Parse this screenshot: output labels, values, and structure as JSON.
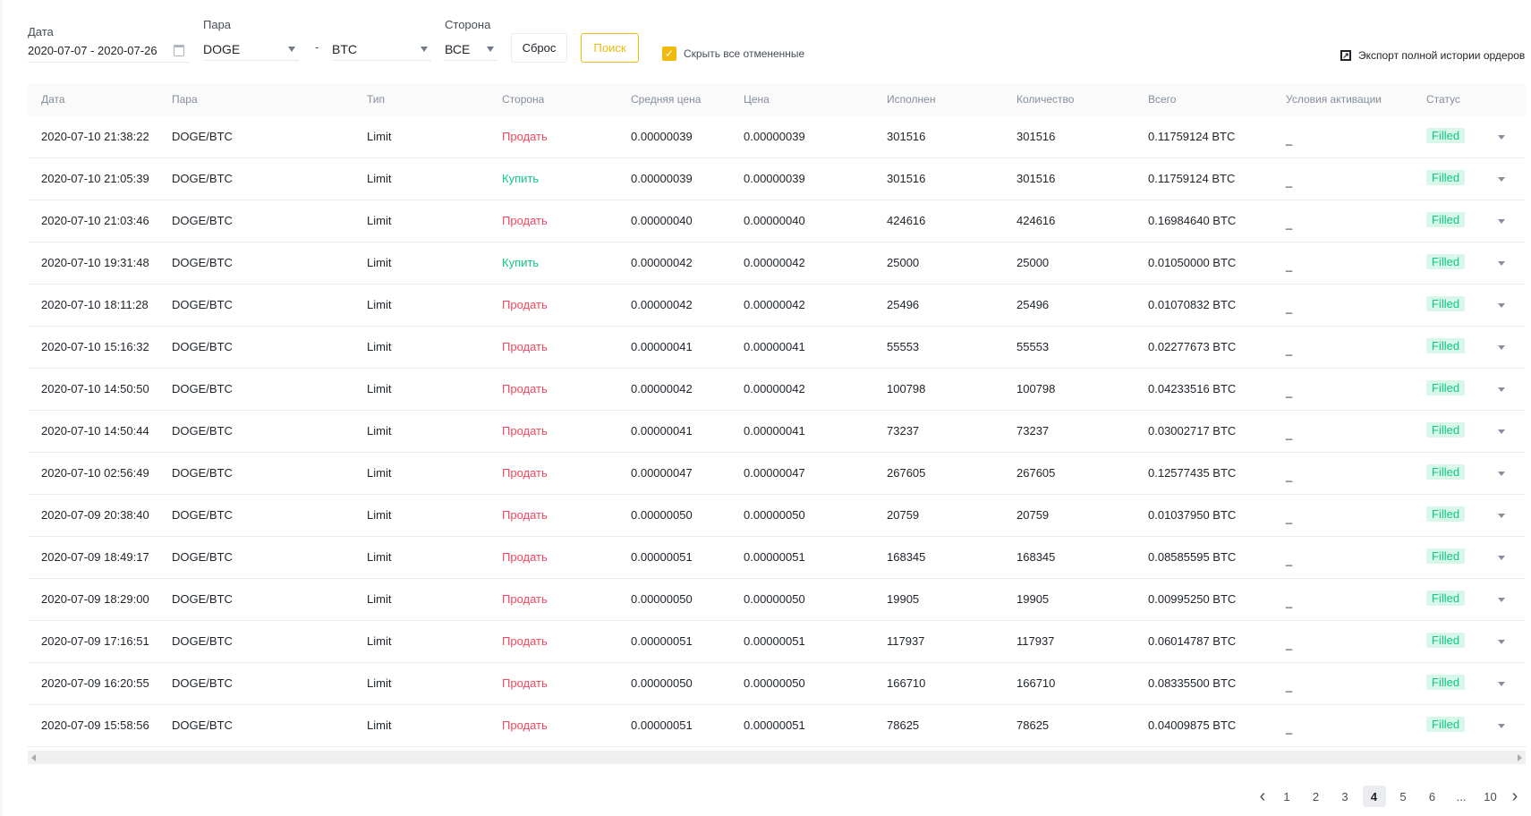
{
  "filters": {
    "date_label": "Дата",
    "date_value": "2020-07-07 - 2020-07-26",
    "pair_label": "Пара",
    "base": "DOGE",
    "dash": "-",
    "quote": "BTC",
    "side_label": "Сторона",
    "side_value": "ВСЕ",
    "reset": "Сброс",
    "search": "Поиск",
    "hide_cancelled": "Скрыть все отмененные",
    "export": "Экспорт полной истории ордеров"
  },
  "columns": [
    "Дата",
    "Пара",
    "Тип",
    "Сторона",
    "Средняя цена",
    "Цена",
    "Исполнен",
    "Количество",
    "Всего",
    "Условия активации",
    "Статус"
  ],
  "rows": [
    [
      "2020-07-10 21:38:22",
      "DOGE/BTC",
      "Limit",
      "Продать",
      "0.00000039",
      "0.00000039",
      "301516",
      "301516",
      "0.11759124 BTC",
      "_",
      "Filled"
    ],
    [
      "2020-07-10 21:05:39",
      "DOGE/BTC",
      "Limit",
      "Купить",
      "0.00000039",
      "0.00000039",
      "301516",
      "301516",
      "0.11759124 BTC",
      "_",
      "Filled"
    ],
    [
      "2020-07-10 21:03:46",
      "DOGE/BTC",
      "Limit",
      "Продать",
      "0.00000040",
      "0.00000040",
      "424616",
      "424616",
      "0.16984640 BTC",
      "_",
      "Filled"
    ],
    [
      "2020-07-10 19:31:48",
      "DOGE/BTC",
      "Limit",
      "Купить",
      "0.00000042",
      "0.00000042",
      "25000",
      "25000",
      "0.01050000 BTC",
      "_",
      "Filled"
    ],
    [
      "2020-07-10 18:11:28",
      "DOGE/BTC",
      "Limit",
      "Продать",
      "0.00000042",
      "0.00000042",
      "25496",
      "25496",
      "0.01070832 BTC",
      "_",
      "Filled"
    ],
    [
      "2020-07-10 15:16:32",
      "DOGE/BTC",
      "Limit",
      "Продать",
      "0.00000041",
      "0.00000041",
      "55553",
      "55553",
      "0.02277673 BTC",
      "_",
      "Filled"
    ],
    [
      "2020-07-10 14:50:50",
      "DOGE/BTC",
      "Limit",
      "Продать",
      "0.00000042",
      "0.00000042",
      "100798",
      "100798",
      "0.04233516 BTC",
      "_",
      "Filled"
    ],
    [
      "2020-07-10 14:50:44",
      "DOGE/BTC",
      "Limit",
      "Продать",
      "0.00000041",
      "0.00000041",
      "73237",
      "73237",
      "0.03002717 BTC",
      "_",
      "Filled"
    ],
    [
      "2020-07-10 02:56:49",
      "DOGE/BTC",
      "Limit",
      "Продать",
      "0.00000047",
      "0.00000047",
      "267605",
      "267605",
      "0.12577435 BTC",
      "_",
      "Filled"
    ],
    [
      "2020-07-09 20:38:40",
      "DOGE/BTC",
      "Limit",
      "Продать",
      "0.00000050",
      "0.00000050",
      "20759",
      "20759",
      "0.01037950 BTC",
      "_",
      "Filled"
    ],
    [
      "2020-07-09 18:49:17",
      "DOGE/BTC",
      "Limit",
      "Продать",
      "0.00000051",
      "0.00000051",
      "168345",
      "168345",
      "0.08585595 BTC",
      "_",
      "Filled"
    ],
    [
      "2020-07-09 18:29:00",
      "DOGE/BTC",
      "Limit",
      "Продать",
      "0.00000050",
      "0.00000050",
      "19905",
      "19905",
      "0.00995250 BTC",
      "_",
      "Filled"
    ],
    [
      "2020-07-09 17:16:51",
      "DOGE/BTC",
      "Limit",
      "Продать",
      "0.00000051",
      "0.00000051",
      "117937",
      "117937",
      "0.06014787 BTC",
      "_",
      "Filled"
    ],
    [
      "2020-07-09 16:20:55",
      "DOGE/BTC",
      "Limit",
      "Продать",
      "0.00000050",
      "0.00000050",
      "166710",
      "166710",
      "0.08335500 BTC",
      "_",
      "Filled"
    ],
    [
      "2020-07-09 15:58:56",
      "DOGE/BTC",
      "Limit",
      "Продать",
      "0.00000051",
      "0.00000051",
      "78625",
      "78625",
      "0.04009875 BTC",
      "_",
      "Filled"
    ]
  ],
  "pagination": {
    "pages": [
      "1",
      "2",
      "3",
      "4",
      "5",
      "6",
      "...",
      "10"
    ],
    "current": "4"
  },
  "colors": {
    "accent": "#f0b90b",
    "sell": "#f6465d",
    "buy": "#0ecb81"
  }
}
